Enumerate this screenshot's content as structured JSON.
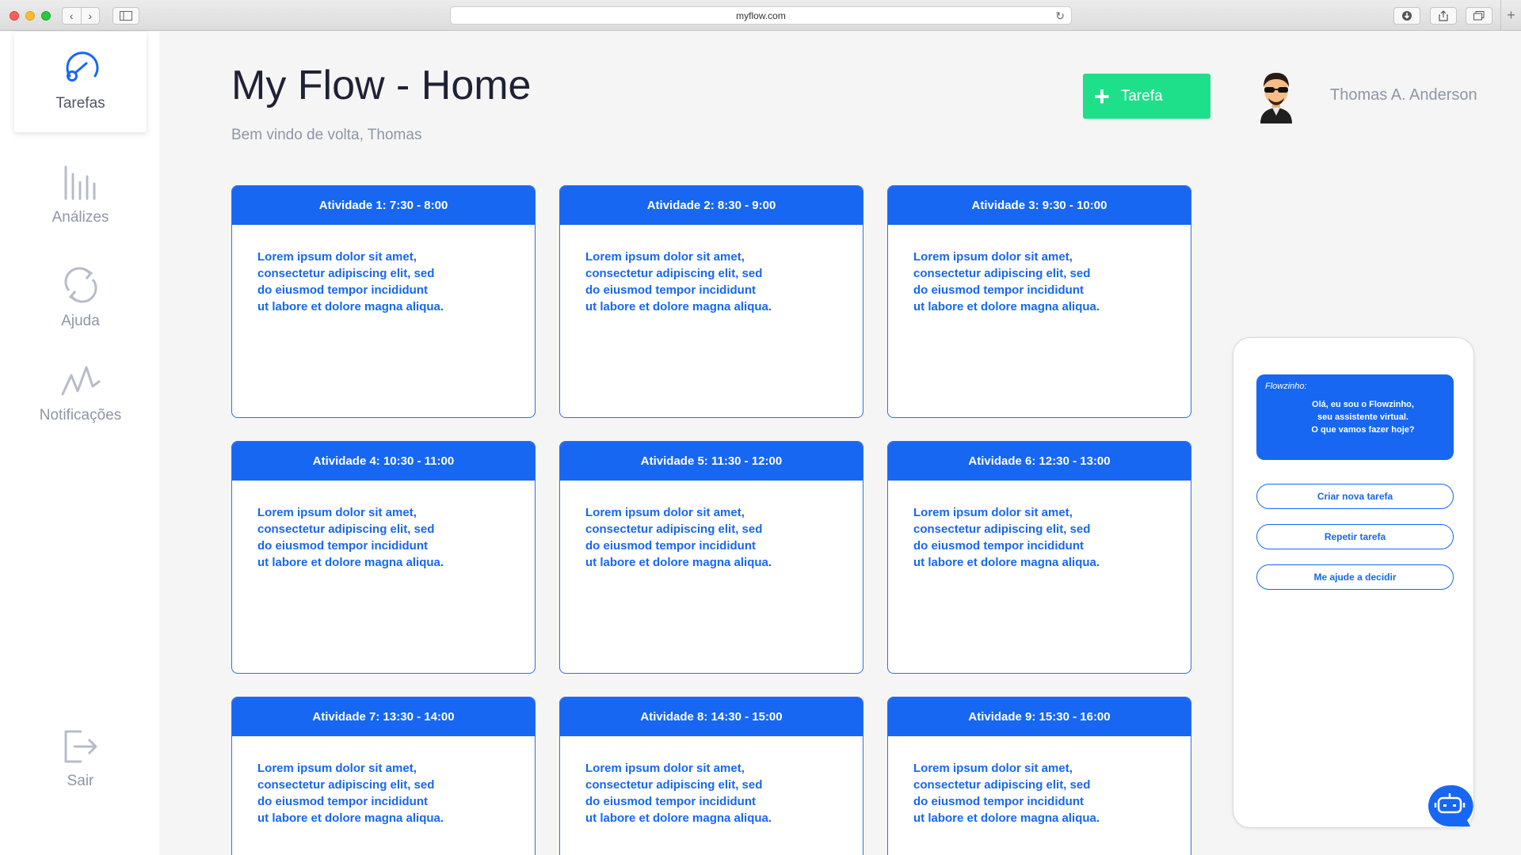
{
  "browser": {
    "url": "myflow.com"
  },
  "sidebar": {
    "items": [
      {
        "label": "Tarefas",
        "icon": "dashboard-gauge-icon"
      },
      {
        "label": "Análizes",
        "icon": "bar-chart-icon"
      },
      {
        "label": "Ajuda",
        "icon": "refresh-icon"
      },
      {
        "label": "Notificações",
        "icon": "activity-wave-icon"
      },
      {
        "label": "Sair",
        "icon": "logout-icon"
      }
    ]
  },
  "header": {
    "title": "My Flow - Home",
    "subtitle": "Bem vindo de volta, Thomas",
    "add_button_label": "Tarefa",
    "user_name": "Thomas A. Anderson"
  },
  "cards": [
    {
      "title": "Atividade 1: 7:30 - 8:00",
      "lines": [
        "Lorem ipsum dolor sit amet,",
        "consectetur adipiscing elit, sed",
        "do eiusmod tempor incididunt",
        "ut labore et dolore magna aliqua."
      ]
    },
    {
      "title": "Atividade 2: 8:30 - 9:00",
      "lines": [
        "Lorem ipsum dolor sit amet,",
        "consectetur adipiscing elit, sed",
        "do eiusmod tempor incididunt",
        "ut labore et dolore magna aliqua."
      ]
    },
    {
      "title": "Atividade 3: 9:30 - 10:00",
      "lines": [
        "Lorem ipsum dolor sit amet,",
        "consectetur adipiscing elit, sed",
        "do eiusmod tempor incididunt",
        "ut labore et dolore magna aliqua."
      ]
    },
    {
      "title": "Atividade 4: 10:30 - 11:00",
      "lines": [
        "Lorem ipsum dolor sit amet,",
        "consectetur adipiscing elit, sed",
        "do eiusmod tempor incididunt",
        "ut labore et dolore magna aliqua."
      ]
    },
    {
      "title": "Atividade 5: 11:30 - 12:00",
      "lines": [
        "Lorem ipsum dolor sit amet,",
        "consectetur adipiscing elit, sed",
        "do eiusmod tempor incididunt",
        "ut labore et dolore magna aliqua."
      ]
    },
    {
      "title": "Atividade 6: 12:30 - 13:00",
      "lines": [
        "Lorem ipsum dolor sit amet,",
        "consectetur adipiscing elit, sed",
        "do eiusmod tempor incididunt",
        "ut labore et dolore magna aliqua."
      ]
    },
    {
      "title": "Atividade 7: 13:30 - 14:00",
      "lines": [
        "Lorem ipsum dolor sit amet,",
        "consectetur adipiscing elit, sed",
        "do eiusmod tempor incididunt",
        "ut labore et dolore magna aliqua."
      ]
    },
    {
      "title": "Atividade 8: 14:30 - 15:00",
      "lines": [
        "Lorem ipsum dolor sit amet,",
        "consectetur adipiscing elit, sed",
        "do eiusmod tempor incididunt",
        "ut labore et dolore magna aliqua."
      ]
    },
    {
      "title": "Atividade 9: 15:30 - 16:00",
      "lines": [
        "Lorem ipsum dolor sit amet,",
        "consectetur adipiscing elit, sed",
        "do eiusmod tempor incididunt",
        "ut labore et dolore magna aliqua."
      ]
    }
  ],
  "assistant": {
    "name": "Flowzinho:",
    "message": [
      "Olá, eu sou o Flowzinho,",
      "seu assistente virtual.",
      "O que vamos fazer hoje?"
    ],
    "options": [
      "Criar nova tarefa",
      "Repetir tarefa",
      "Me ajude a decidir"
    ]
  },
  "colors": {
    "primary": "#1767f2",
    "accent": "#1fe08a",
    "muted_text": "#8e96a6"
  }
}
